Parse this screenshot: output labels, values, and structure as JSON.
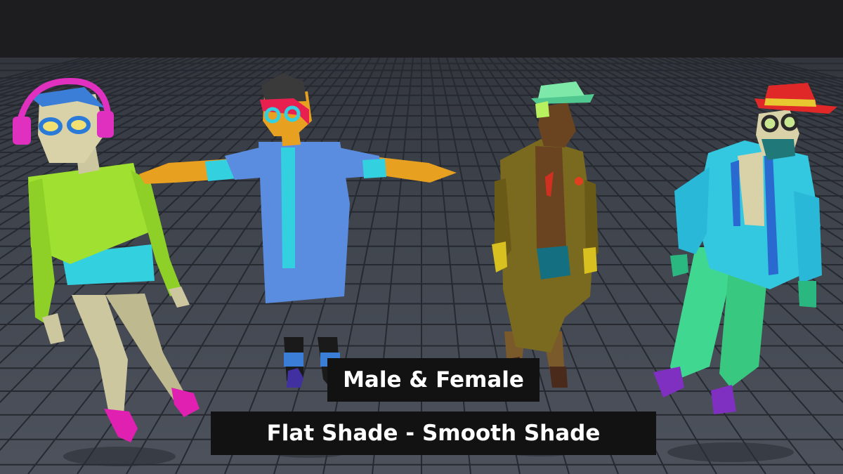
{
  "captions": {
    "line1": "Male & Female",
    "line2": "Flat Shade - Smooth Shade"
  },
  "colors": {
    "background_top": "#1d1d1f",
    "floor": "#4a4f5a",
    "grid_lines": "#2a2d35",
    "caption_bg": "#121212",
    "caption_text": "#ffffff"
  },
  "characters": [
    {
      "name": "female-headphones",
      "accessories": [
        "headphones",
        "glasses"
      ],
      "top": "#9fe030",
      "bottom": "#33d0e0",
      "shoes": "#e020b0"
    },
    {
      "name": "female-lab-coat",
      "accessories": [
        "glasses",
        "hair-bun"
      ],
      "top": "#5a8de0",
      "bottom": "#1a1a1a",
      "shoes": "#4030a0"
    },
    {
      "name": "male-trench-coat",
      "accessories": [
        "hat"
      ],
      "top": "#7a6a20",
      "bottom": "#147080",
      "shoes": "#4a2a1a"
    },
    {
      "name": "male-jacket-hat",
      "accessories": [
        "hat",
        "glasses",
        "mask"
      ],
      "top": "#33c8e0",
      "bottom": "#40d890",
      "shoes": "#8030c0"
    }
  ]
}
